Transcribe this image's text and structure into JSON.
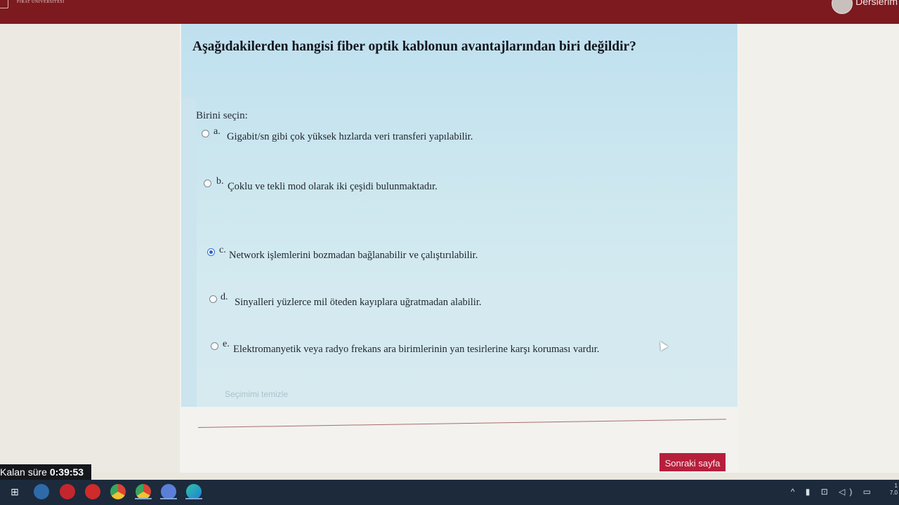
{
  "header": {
    "logo_text": "FIRAT ÜNİVERSİTESİ",
    "courses_link": "Derslerim"
  },
  "quiz": {
    "question": "Aşağıdakilerden hangisi fiber optik kablonun avantajlarından biri değildir?",
    "prompt": "Birini seçin:",
    "options": [
      {
        "letter": "a.",
        "text": "Gigabit/sn gibi çok yüksek hızlarda veri transferi yapılabilir.",
        "selected": false
      },
      {
        "letter": "b.",
        "text": "Çoklu ve tekli mod olarak iki çeşidi bulunmaktadır.",
        "selected": false
      },
      {
        "letter": "c.",
        "text": "Network işlemlerini bozmadan bağlanabilir ve  çalıştırılabilir.",
        "selected": true
      },
      {
        "letter": "d.",
        "text": "Sinyalleri yüzlerce mil öteden kayıplara uğratmadan alabilir.",
        "selected": false
      },
      {
        "letter": "e.",
        "text": "Elektromanyetik veya radyo frekans ara birimlerinin yan tesirlerine karşı koruması vardır.",
        "selected": false
      }
    ],
    "clear_selection": "Seçimimi temizle",
    "next_page": "Sonraki sayfa"
  },
  "timer": {
    "label": "Kalan süre",
    "value": "0:39:53"
  },
  "taskbar": {
    "icons": [
      "task-view-icon",
      "steam-icon",
      "media-player-icon",
      "opera-icon",
      "chrome-icon",
      "chrome-profile-icon",
      "video-call-icon",
      "edge-icon"
    ],
    "tray": "^ ▮ ⊡ ◁) ▭",
    "clock_time": "1",
    "clock_date": "7.0"
  },
  "colors": {
    "brand_bar": "#7c1a1f",
    "next_button": "#b61f3b",
    "card": "#cbe6ef",
    "selected_radio": "#2563d8"
  }
}
